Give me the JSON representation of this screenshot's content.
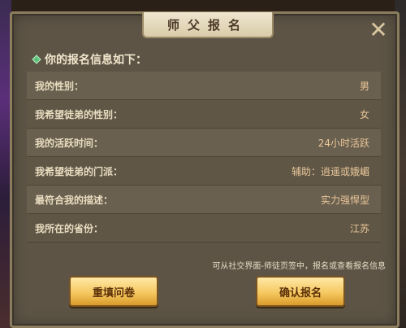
{
  "dialog": {
    "title": "师父报名",
    "close_icon": "close-x-icon",
    "header": "你的报名信息如下：",
    "rows": [
      {
        "label": "我的性别：",
        "value": "男"
      },
      {
        "label": "我希望徒弟的性别：",
        "value": "女"
      },
      {
        "label": "我的活跃时间：",
        "value": "24小时活跃"
      },
      {
        "label": "我希望徒弟的门派：",
        "value": "辅助：逍遥或娥嵋"
      },
      {
        "label": "最符合我的描述：",
        "value": "实力强悍型"
      },
      {
        "label": "我所在的省份：",
        "value": "江苏"
      }
    ],
    "hint": "可从社交界面-师徒页签中，报名或查看报名信息",
    "buttons": {
      "refill": "重填问卷",
      "confirm": "确认报名"
    }
  }
}
